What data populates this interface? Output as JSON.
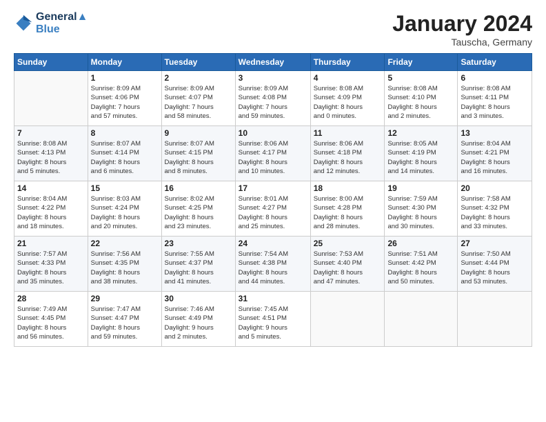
{
  "logo": {
    "line1": "General",
    "line2": "Blue"
  },
  "title": "January 2024",
  "subtitle": "Tauscha, Germany",
  "weekdays": [
    "Sunday",
    "Monday",
    "Tuesday",
    "Wednesday",
    "Thursday",
    "Friday",
    "Saturday"
  ],
  "weeks": [
    [
      {
        "day": "",
        "info": ""
      },
      {
        "day": "1",
        "info": "Sunrise: 8:09 AM\nSunset: 4:06 PM\nDaylight: 7 hours\nand 57 minutes."
      },
      {
        "day": "2",
        "info": "Sunrise: 8:09 AM\nSunset: 4:07 PM\nDaylight: 7 hours\nand 58 minutes."
      },
      {
        "day": "3",
        "info": "Sunrise: 8:09 AM\nSunset: 4:08 PM\nDaylight: 7 hours\nand 59 minutes."
      },
      {
        "day": "4",
        "info": "Sunrise: 8:08 AM\nSunset: 4:09 PM\nDaylight: 8 hours\nand 0 minutes."
      },
      {
        "day": "5",
        "info": "Sunrise: 8:08 AM\nSunset: 4:10 PM\nDaylight: 8 hours\nand 2 minutes."
      },
      {
        "day": "6",
        "info": "Sunrise: 8:08 AM\nSunset: 4:11 PM\nDaylight: 8 hours\nand 3 minutes."
      }
    ],
    [
      {
        "day": "7",
        "info": "Sunrise: 8:08 AM\nSunset: 4:13 PM\nDaylight: 8 hours\nand 5 minutes."
      },
      {
        "day": "8",
        "info": "Sunrise: 8:07 AM\nSunset: 4:14 PM\nDaylight: 8 hours\nand 6 minutes."
      },
      {
        "day": "9",
        "info": "Sunrise: 8:07 AM\nSunset: 4:15 PM\nDaylight: 8 hours\nand 8 minutes."
      },
      {
        "day": "10",
        "info": "Sunrise: 8:06 AM\nSunset: 4:17 PM\nDaylight: 8 hours\nand 10 minutes."
      },
      {
        "day": "11",
        "info": "Sunrise: 8:06 AM\nSunset: 4:18 PM\nDaylight: 8 hours\nand 12 minutes."
      },
      {
        "day": "12",
        "info": "Sunrise: 8:05 AM\nSunset: 4:19 PM\nDaylight: 8 hours\nand 14 minutes."
      },
      {
        "day": "13",
        "info": "Sunrise: 8:04 AM\nSunset: 4:21 PM\nDaylight: 8 hours\nand 16 minutes."
      }
    ],
    [
      {
        "day": "14",
        "info": "Sunrise: 8:04 AM\nSunset: 4:22 PM\nDaylight: 8 hours\nand 18 minutes."
      },
      {
        "day": "15",
        "info": "Sunrise: 8:03 AM\nSunset: 4:24 PM\nDaylight: 8 hours\nand 20 minutes."
      },
      {
        "day": "16",
        "info": "Sunrise: 8:02 AM\nSunset: 4:25 PM\nDaylight: 8 hours\nand 23 minutes."
      },
      {
        "day": "17",
        "info": "Sunrise: 8:01 AM\nSunset: 4:27 PM\nDaylight: 8 hours\nand 25 minutes."
      },
      {
        "day": "18",
        "info": "Sunrise: 8:00 AM\nSunset: 4:28 PM\nDaylight: 8 hours\nand 28 minutes."
      },
      {
        "day": "19",
        "info": "Sunrise: 7:59 AM\nSunset: 4:30 PM\nDaylight: 8 hours\nand 30 minutes."
      },
      {
        "day": "20",
        "info": "Sunrise: 7:58 AM\nSunset: 4:32 PM\nDaylight: 8 hours\nand 33 minutes."
      }
    ],
    [
      {
        "day": "21",
        "info": "Sunrise: 7:57 AM\nSunset: 4:33 PM\nDaylight: 8 hours\nand 35 minutes."
      },
      {
        "day": "22",
        "info": "Sunrise: 7:56 AM\nSunset: 4:35 PM\nDaylight: 8 hours\nand 38 minutes."
      },
      {
        "day": "23",
        "info": "Sunrise: 7:55 AM\nSunset: 4:37 PM\nDaylight: 8 hours\nand 41 minutes."
      },
      {
        "day": "24",
        "info": "Sunrise: 7:54 AM\nSunset: 4:38 PM\nDaylight: 8 hours\nand 44 minutes."
      },
      {
        "day": "25",
        "info": "Sunrise: 7:53 AM\nSunset: 4:40 PM\nDaylight: 8 hours\nand 47 minutes."
      },
      {
        "day": "26",
        "info": "Sunrise: 7:51 AM\nSunset: 4:42 PM\nDaylight: 8 hours\nand 50 minutes."
      },
      {
        "day": "27",
        "info": "Sunrise: 7:50 AM\nSunset: 4:44 PM\nDaylight: 8 hours\nand 53 minutes."
      }
    ],
    [
      {
        "day": "28",
        "info": "Sunrise: 7:49 AM\nSunset: 4:45 PM\nDaylight: 8 hours\nand 56 minutes."
      },
      {
        "day": "29",
        "info": "Sunrise: 7:47 AM\nSunset: 4:47 PM\nDaylight: 8 hours\nand 59 minutes."
      },
      {
        "day": "30",
        "info": "Sunrise: 7:46 AM\nSunset: 4:49 PM\nDaylight: 9 hours\nand 2 minutes."
      },
      {
        "day": "31",
        "info": "Sunrise: 7:45 AM\nSunset: 4:51 PM\nDaylight: 9 hours\nand 5 minutes."
      },
      {
        "day": "",
        "info": ""
      },
      {
        "day": "",
        "info": ""
      },
      {
        "day": "",
        "info": ""
      }
    ]
  ]
}
